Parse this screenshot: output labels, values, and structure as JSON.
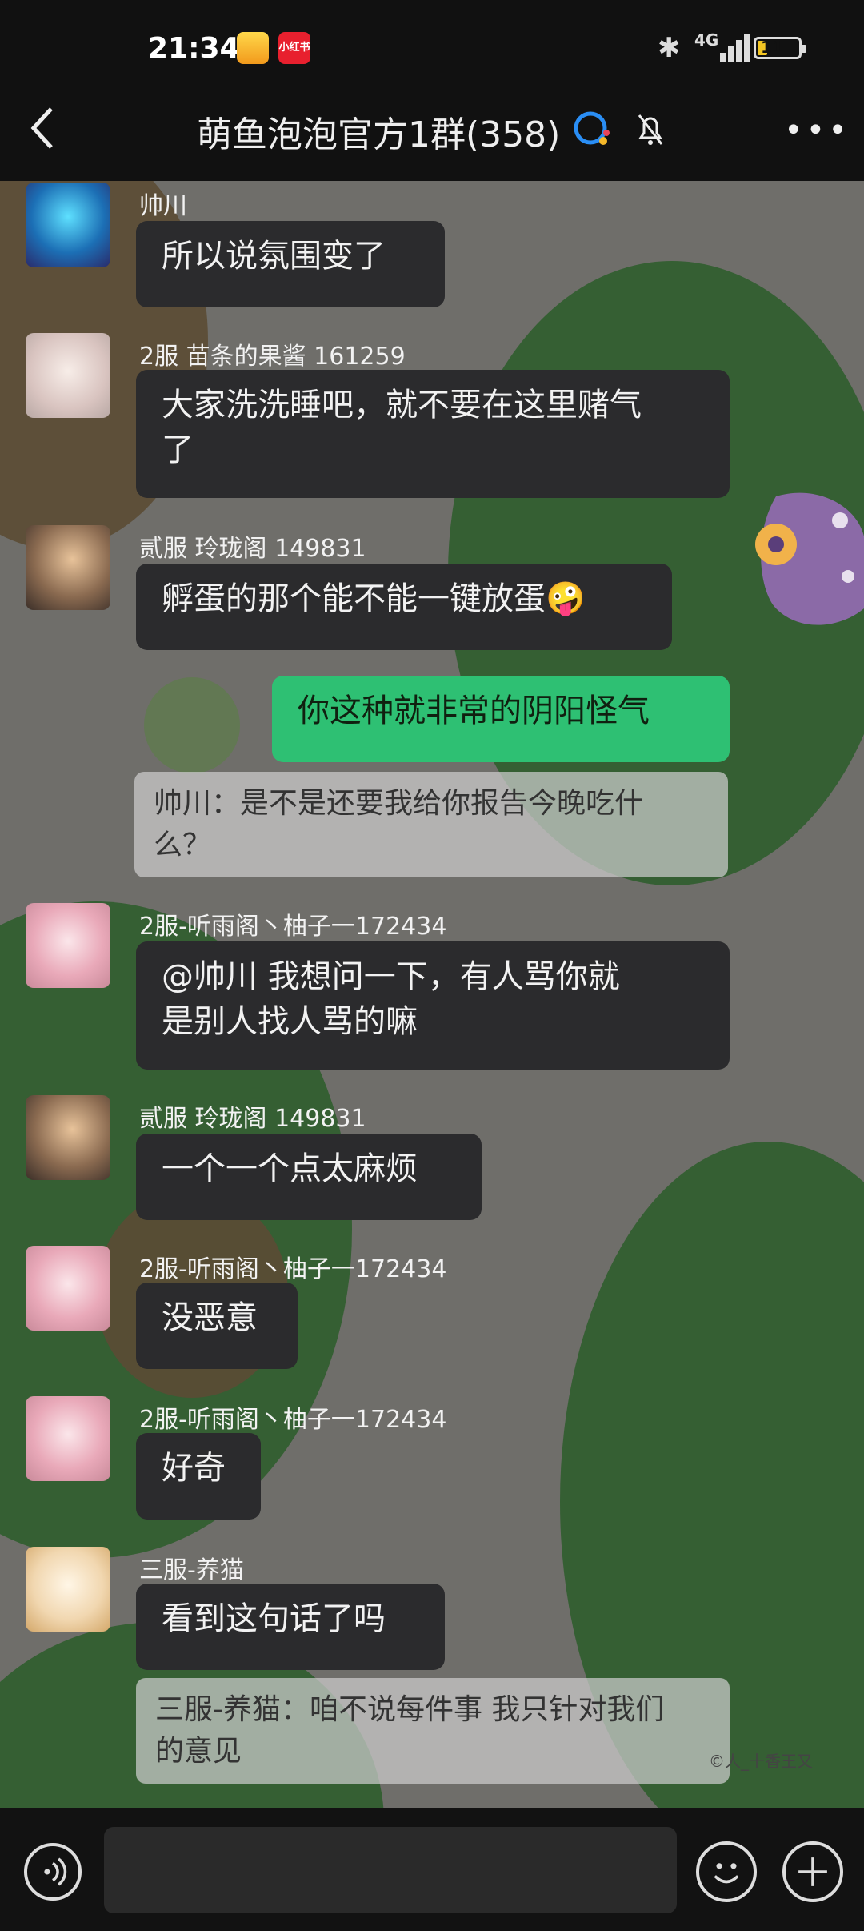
{
  "status_bar": {
    "time": "21:34",
    "app_badge_2": "小红书",
    "network": "4G",
    "battery_level": "11"
  },
  "header": {
    "title": "萌鱼泡泡官方1群(358)",
    "icons": [
      "back-arrow-icon",
      "qq-icon",
      "bell-muted-icon",
      "more-icon"
    ]
  },
  "messages": [
    {
      "name": "帅川",
      "text": "所以说氛围变了"
    },
    {
      "name": "2服 苗条的果酱 161259",
      "text_line1": "大家洗洗睡吧，就不要在这里赌气",
      "text_line2": "了"
    },
    {
      "name": "贰服 玲珑阁  149831",
      "text": "孵蛋的那个能不能一键放蛋🤪"
    },
    {
      "mine": true,
      "text": "你这种就非常的阴阳怪气"
    },
    {
      "quote_line1": "帅川：是不是还要我给你报告今晚吃什",
      "quote_line2": "么？"
    },
    {
      "name": "2服-听雨阁丶柚子一172434",
      "text_line1": "@帅川  我想问一下，有人骂你就",
      "text_line2": "是别人找人骂的嘛"
    },
    {
      "name": "贰服 玲珑阁  149831",
      "text": "一个一个点太麻烦"
    },
    {
      "name": "2服-听雨阁丶柚子一172434",
      "text": "没恶意"
    },
    {
      "name": "2服-听雨阁丶柚子一172434",
      "text": "好奇"
    },
    {
      "name": "三服-养猫",
      "text": "看到这句话了吗"
    },
    {
      "quote_line1": "三服-养猫：咱不说每件事 我只针对我们",
      "quote_line2": "的意见"
    }
  ],
  "watermark": "©人_十香王又",
  "input": {
    "placeholder": ""
  },
  "colors": {
    "bubble_other": "#2b2b2d",
    "bubble_mine": "#2ec073",
    "background": "#111111"
  }
}
